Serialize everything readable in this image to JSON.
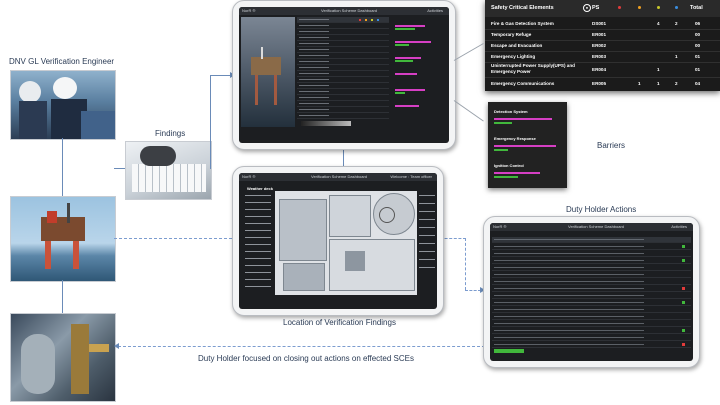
{
  "labels": {
    "engineer": "DNV GL Verification  Engineer",
    "findings": "Findings",
    "barriers": "Barriers",
    "duty_holder_actions": "Duty Holder Actions",
    "location": "Location of Verification Findings",
    "closing": "Duty Holder focused  on closing out actions on effected SCEs"
  },
  "tablet_top": {
    "logo": "NorR ®",
    "title": "Verification Scheme Dashboard",
    "right": "Activities"
  },
  "tablet_mid": {
    "logo": "NorR ®",
    "title": "Verification Scheme Dashboard",
    "right": "Welcome : Team officer",
    "section": "Weather deck"
  },
  "tablet_bottom": {
    "logo": "NorR ®",
    "title": "Verification Scheme Dashboard",
    "right": "Activities"
  },
  "sce": {
    "header": "Safety Critical Elements",
    "ps": "PS",
    "total": "Total",
    "dot_colors": [
      "#e23b3b",
      "#f0a020",
      "#c7c72a",
      "#3a8ee0"
    ],
    "rows": [
      {
        "name": "Fire & Gas Detection System",
        "code": "DS001",
        "c3": "4",
        "c4": "2",
        "total": "06"
      },
      {
        "name": "Temporary Refuge",
        "code": "ER001",
        "c3": "",
        "c4": "",
        "total": "00"
      },
      {
        "name": "Escape and Evacuation",
        "code": "ER002",
        "c3": "",
        "c4": "",
        "total": "00"
      },
      {
        "name": "Emergency Lighting",
        "code": "ER003",
        "c3": "",
        "c4": "1",
        "total": "01"
      },
      {
        "name": "Uninterrupted Power Supply(UPS) and Emergency Power",
        "code": "ER004",
        "c3": "1",
        "c4": "",
        "total": "01"
      },
      {
        "name": "Emergency Communications",
        "code": "ER005",
        "c3": "1",
        "c4": "2",
        "total": "04",
        "c2": "1"
      }
    ]
  },
  "barriers_panel": {
    "items": [
      "Detection System",
      "Emergency Response",
      "Ignition Control"
    ],
    "bar_colors": [
      "#d63fc4",
      "#41b83c"
    ]
  }
}
